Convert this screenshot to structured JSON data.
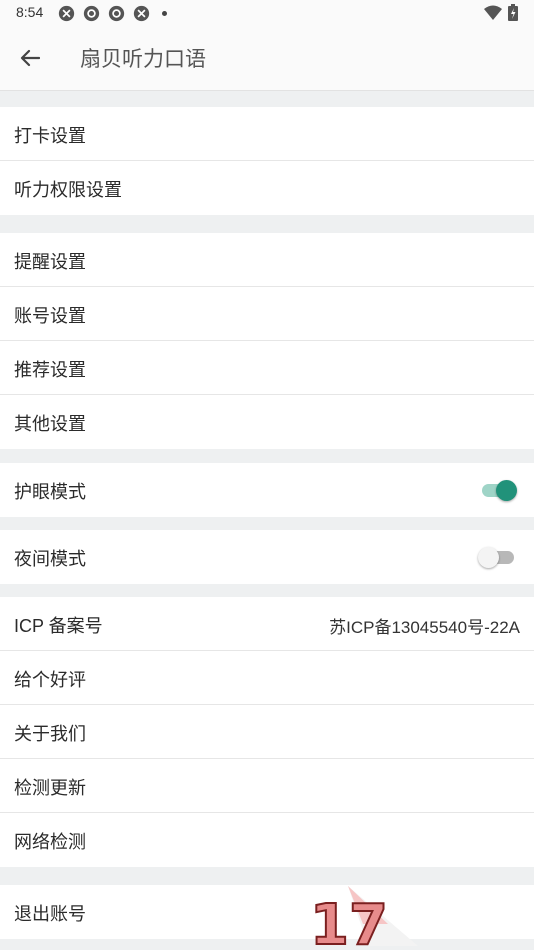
{
  "status_bar": {
    "time": "8:54",
    "icons": [
      "bluetooth-like-icon",
      "chrome-like-icon",
      "chrome-like-icon",
      "bluetooth-like-icon"
    ],
    "right_icons": [
      "wifi-icon",
      "battery-icon"
    ]
  },
  "app_bar": {
    "title": "扇贝听力口语"
  },
  "groups": {
    "g1": [
      "打卡设置",
      "听力权限设置"
    ],
    "g2": [
      "提醒设置",
      "账号设置",
      "推荐设置",
      "其他设置"
    ],
    "eye_mode": {
      "label": "护眼模式",
      "enabled": true
    },
    "night_mode": {
      "label": "夜间模式",
      "enabled": false
    },
    "g5": {
      "icp_label": "ICP 备案号",
      "icp_value": "苏ICP备13045540号-22A",
      "items": [
        "给个好评",
        "关于我们",
        "检测更新",
        "网络检测"
      ]
    },
    "logout": "退出账号"
  },
  "watermark_text": "17",
  "colors": {
    "accent": "#21927a",
    "accent_track": "#9fd4c7",
    "background": "#eef0f1"
  }
}
